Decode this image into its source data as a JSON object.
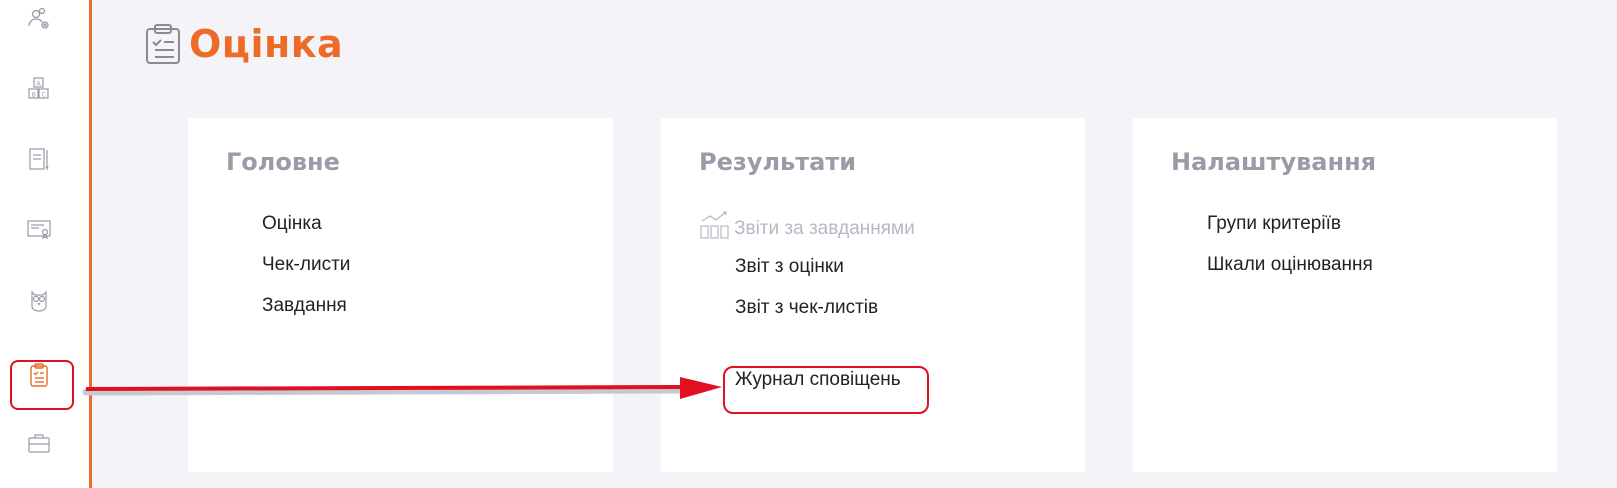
{
  "sidebar": {
    "items": [
      {
        "icon": "people-gear-icon"
      },
      {
        "icon": "abc-blocks-icon"
      },
      {
        "icon": "notebook-pencil-icon"
      },
      {
        "icon": "certificate-icon"
      },
      {
        "icon": "owl-icon"
      },
      {
        "icon": "clipboard-checklist-icon",
        "active": true
      },
      {
        "icon": "briefcase-icon"
      }
    ]
  },
  "page": {
    "title": "Оцінка",
    "icon": "clipboard-checklist-icon"
  },
  "cards": {
    "main": {
      "title": "Головне",
      "links": [
        "Оцінка",
        "Чек-листи",
        "Завдання"
      ]
    },
    "results": {
      "title": "Результати",
      "section_label": "Звіти за завданнями",
      "section_icon": "bar-chart-icon",
      "links": [
        "Звіт з оцінки",
        "Звіт з чек-листів"
      ],
      "notifications_link": "Журнал сповіщень"
    },
    "settings": {
      "title": "Налаштування",
      "links": [
        "Групи критеріїв",
        "Шкали оцінювання"
      ]
    }
  },
  "colors": {
    "accent": "#ec6b28",
    "annotation": "#e01020",
    "heading_gray": "#9b9ba8",
    "background": "#f4f4f8"
  }
}
